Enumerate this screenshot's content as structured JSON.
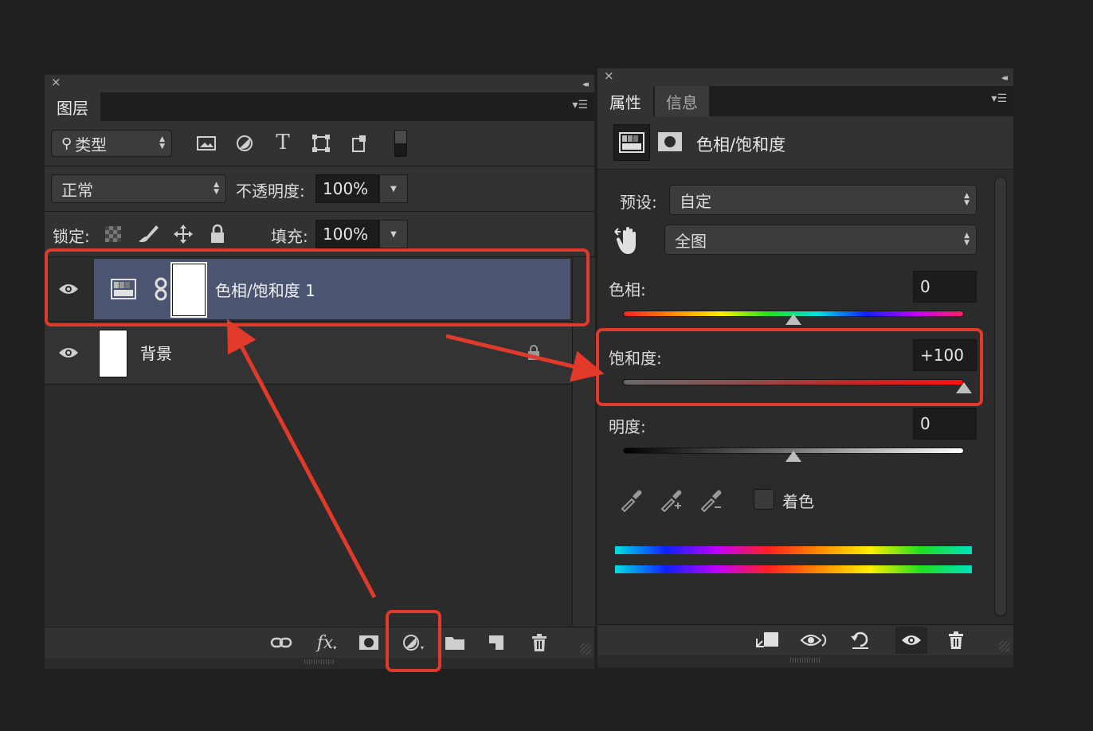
{
  "layers_panel": {
    "close_glyph": "×",
    "collapse_glyph": "◂◂",
    "tab_label": "图层",
    "filter_select": "类型",
    "blend_mode": "正常",
    "opacity_label": "不透明度:",
    "opacity_value": "100%",
    "lock_label": "锁定:",
    "fill_label": "填充:",
    "fill_value": "100%",
    "layers": [
      {
        "name": "色相/饱和度 1",
        "selected": true
      },
      {
        "name": "背景",
        "selected": false
      }
    ],
    "filter_icons": [
      "image-filter-icon",
      "adjustment-filter-icon",
      "type-filter-icon",
      "shape-filter-icon",
      "smart-object-filter-icon",
      "filter-toggle-icon"
    ],
    "bottom_icons": [
      "link-layers-icon",
      "fx-icon",
      "add-mask-icon",
      "new-adjustment-layer-icon",
      "new-group-icon",
      "new-layer-icon",
      "delete-layer-icon"
    ],
    "fx_text": "fx"
  },
  "properties_panel": {
    "close_glyph": "×",
    "collapse_glyph": "◂◂",
    "tabs": [
      {
        "label": "属性",
        "active": true
      },
      {
        "label": "信息",
        "active": false
      }
    ],
    "header_title": "色相/饱和度",
    "preset_label": "预设:",
    "preset_value": "自定",
    "channel_value": "全图",
    "hue_label": "色相:",
    "hue_value": "0",
    "hue_level": 0,
    "saturation_label": "饱和度:",
    "saturation_value": "+100",
    "saturation_level": 100,
    "lightness_label": "明度:",
    "lightness_value": "0",
    "lightness_level": 0,
    "colorize_label": "着色",
    "colorize_checked": false,
    "bottom_icons": [
      "clip-to-layer-icon",
      "view-previous-icon",
      "reset-icon",
      "visibility-eye-icon",
      "delete-icon"
    ]
  },
  "colors": {
    "annotation_red": "#e23a2a",
    "selected_layer": "#4b5470",
    "panel_bg": "#2b2b2b"
  }
}
